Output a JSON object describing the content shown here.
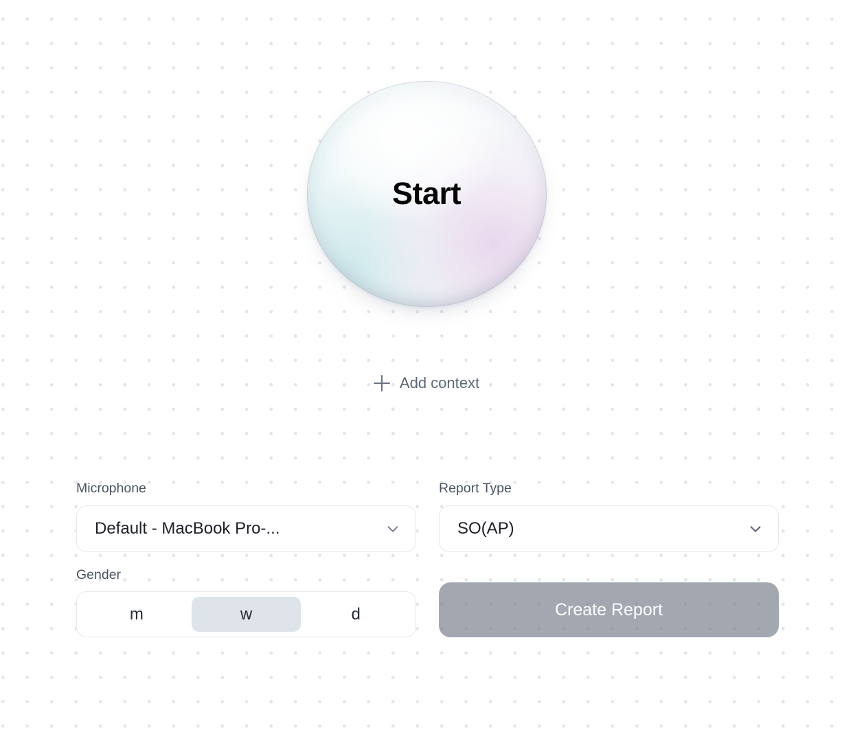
{
  "start": {
    "label": "Start",
    "icon": "sphere-orb"
  },
  "add_context": {
    "label": "Add context",
    "icon": "plus-icon"
  },
  "form": {
    "microphone": {
      "label": "Microphone",
      "value": "Default - MacBook Pro-...",
      "icon": "chevron-down-icon"
    },
    "report_type": {
      "label": "Report Type",
      "value": "SO(AP)",
      "icon": "chevron-down-icon"
    },
    "gender": {
      "label": "Gender",
      "options": [
        {
          "label": "m",
          "selected": false
        },
        {
          "label": "w",
          "selected": true
        },
        {
          "label": "d",
          "selected": false
        }
      ],
      "selected": "w"
    },
    "create_report": {
      "label": "Create Report",
      "disabled": true
    }
  },
  "colors": {
    "background": "#ffffff",
    "dot_grid": "#e3e4ec",
    "label_text": "#4b5361",
    "value_text": "#1c1f26",
    "muted_text": "#5e6675",
    "field_border": "#e6e8ee",
    "segment_selected": "#dee4e9",
    "primary_button": "#6b7280",
    "primary_button_text": "#ffffff"
  }
}
